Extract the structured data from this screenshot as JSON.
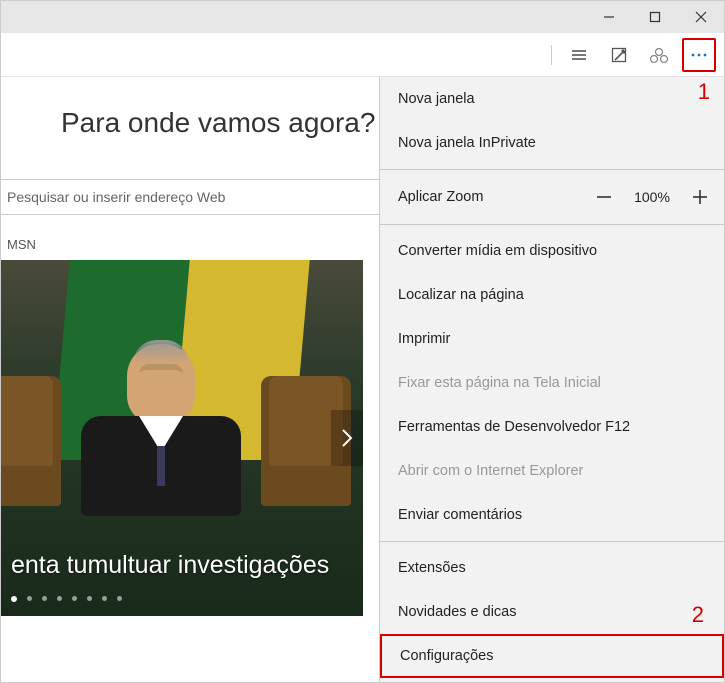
{
  "window": {
    "minimize": "min",
    "maximize": "max",
    "close": "close"
  },
  "toolbar": {
    "reading_list": "reading-list",
    "note": "note",
    "share": "share",
    "more": "more"
  },
  "page": {
    "heading": "Para onde vamos agora?",
    "search_placeholder": "Pesquisar ou inserir endereço Web",
    "section_label": "MSN",
    "hero_headline": "enta tumultuar investigações"
  },
  "menu": {
    "new_window": "Nova janela",
    "new_inprivate": "Nova janela InPrivate",
    "zoom_label": "Aplicar Zoom",
    "zoom_value": "100%",
    "cast": "Converter mídia em dispositivo",
    "find": "Localizar na página",
    "print": "Imprimir",
    "pin": "Fixar esta página na Tela Inicial",
    "devtools": "Ferramentas de Desenvolvedor F12",
    "open_ie": "Abrir com o Internet Explorer",
    "feedback": "Enviar comentários",
    "extensions": "Extensões",
    "news_tips": "Novidades e dicas",
    "settings": "Configurações"
  },
  "annotations": {
    "one": "1",
    "two": "2"
  }
}
